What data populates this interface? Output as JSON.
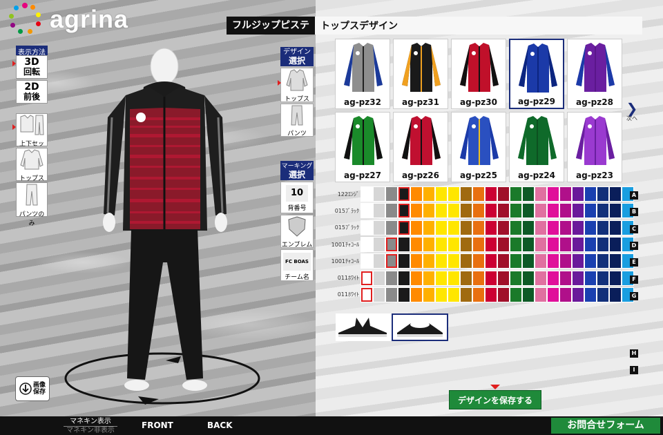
{
  "brand": {
    "name": "agrina"
  },
  "display_mode": {
    "header": "表示方法",
    "btn_3d": {
      "main": "3D",
      "sub": "回転"
    },
    "btn_2d": {
      "main": "2D",
      "sub": "前後"
    }
  },
  "set_options": [
    {
      "label": "上下セット",
      "icon": "jacket-and-pants-icon"
    },
    {
      "label": "トップスのみ",
      "icon": "jacket-icon"
    },
    {
      "label": "パンツのみ",
      "icon": "pants-icon"
    }
  ],
  "save_image": {
    "label_line1": "画像",
    "label_line2": "保存"
  },
  "design_select": {
    "header_line1": "デザイン",
    "header_line2": "選択",
    "items": [
      {
        "label": "トップス"
      },
      {
        "label": "パンツ"
      }
    ]
  },
  "marking_select": {
    "header_line1": "マーキング",
    "header_line2": "選択",
    "items": [
      {
        "label": "背番号",
        "preview": "10"
      },
      {
        "label": "エンブレム"
      },
      {
        "label": "チーム名",
        "preview": "FC BOAS"
      }
    ]
  },
  "title": {
    "product": "フルジップピステ",
    "section": "トップスデザイン"
  },
  "designs": [
    {
      "code": "ag-pz32",
      "body": "#8e8e8e",
      "sleeve": "#1b3a9a",
      "accent": "#222",
      "selected": false
    },
    {
      "code": "ag-pz31",
      "body": "#1a1a1a",
      "sleeve": "#f0a020",
      "accent": "#f0a020",
      "selected": false
    },
    {
      "code": "ag-pz30",
      "body": "#c0102a",
      "sleeve": "#111",
      "accent": "#111",
      "selected": false
    },
    {
      "code": "ag-pz29",
      "body": "#1b3aa8",
      "sleeve": "#0c2580",
      "accent": "#0c2580",
      "selected": true
    },
    {
      "code": "ag-pz28",
      "body": "#6a1fa0",
      "sleeve": "#1b3aa8",
      "accent": "#5a168a",
      "selected": false
    },
    {
      "code": "ag-pz27",
      "body": "#1a8a2a",
      "sleeve": "#111",
      "accent": "#111",
      "selected": false
    },
    {
      "code": "ag-pz26",
      "body": "#c01030",
      "sleeve": "#111",
      "accent": "#111",
      "selected": false
    },
    {
      "code": "ag-pz25",
      "body": "#2a50c0",
      "sleeve": "#1b3aa8",
      "accent": "#f0c020",
      "selected": false
    },
    {
      "code": "ag-pz24",
      "body": "#0f6a2a",
      "sleeve": "#0f6a2a",
      "accent": "#0d5020",
      "selected": false
    },
    {
      "code": "ag-pz23",
      "body": "#9a3ad0",
      "sleeve": "#6a1fa0",
      "accent": "#6a1fa0",
      "selected": false
    }
  ],
  "next_page": {
    "label": "次へ"
  },
  "palette": [
    "#ffffff",
    "#d6d6d6",
    "#8a8a8a",
    "#1a1a1a",
    "#ff8a00",
    "#ffb000",
    "#ffe600",
    "#ffe600",
    "#a06a10",
    "#e87010",
    "#cc0033",
    "#a0102a",
    "#1a7a2a",
    "#0d5a26",
    "#e070a0",
    "#e0109a",
    "#b0108a",
    "#6a1a9a",
    "#1a40b0",
    "#12307a",
    "#0a1e5a",
    "#1a9ee0"
  ],
  "color_rows": [
    {
      "letter": "A",
      "name": "122ｴﾝｼﾞ",
      "picked": 3
    },
    {
      "letter": "B",
      "name": "015ﾌﾞﾗｯｸ",
      "picked": 3
    },
    {
      "letter": "C",
      "name": "015ﾌﾞﾗｯｸ",
      "picked": 3
    },
    {
      "letter": "D",
      "name": "1001ﾁｬｺｰﾙ",
      "picked": 2
    },
    {
      "letter": "E",
      "name": "1001ﾁｬｺｰﾙ",
      "picked": 2
    },
    {
      "letter": "F",
      "name": "011ﾎﾜｲﾄ",
      "picked": 0
    },
    {
      "letter": "G",
      "name": "011ﾎﾜｲﾄ",
      "picked": 0
    }
  ],
  "extra_letters": [
    "H",
    "I"
  ],
  "collar_options": [
    {
      "selected": false
    },
    {
      "selected": true
    }
  ],
  "save_design": {
    "label": "デザインを保存する"
  },
  "bottom_bar": {
    "mannequin_on": "マネキン表示",
    "mannequin_off": "マネキン非表示",
    "front": "FRONT",
    "back": "BACK",
    "contact": "お問合せフォーム"
  }
}
